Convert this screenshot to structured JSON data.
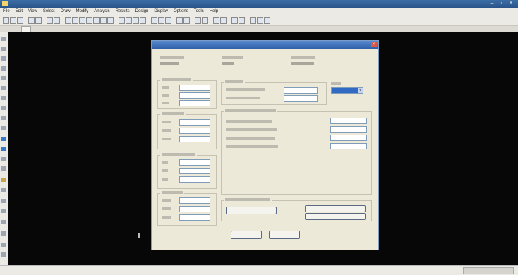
{
  "window": {
    "title": ""
  },
  "menu": [
    "File",
    "Edit",
    "View",
    "Select",
    "Draw",
    "Modify",
    "Analysis",
    "Results",
    "Design",
    "Display",
    "Options",
    "Tools",
    "Help"
  ],
  "tab": {
    "label": ""
  },
  "dialog": {
    "title": "",
    "close": "×",
    "ok": "",
    "cancel": ""
  },
  "colors": {
    "canvas": "#070707",
    "dialog": "#ece9d8",
    "titlebar": "#2e5fa8",
    "selection": "#316ac5"
  }
}
